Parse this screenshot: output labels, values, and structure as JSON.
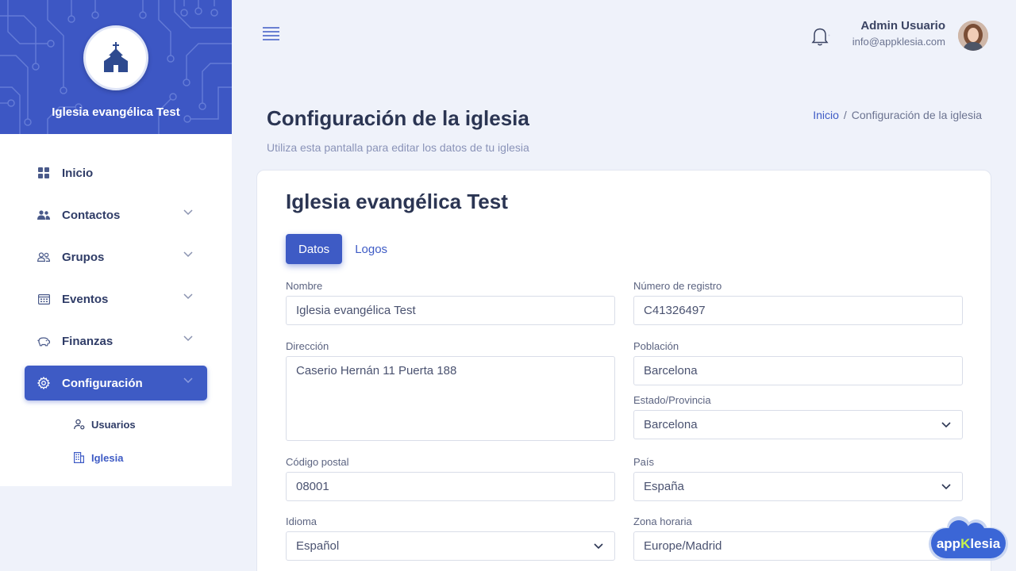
{
  "brand": {
    "name": "Iglesia evangélica Test"
  },
  "nav": {
    "items": [
      {
        "label": "Inicio"
      },
      {
        "label": "Contactos"
      },
      {
        "label": "Grupos"
      },
      {
        "label": "Eventos"
      },
      {
        "label": "Finanzas"
      },
      {
        "label": "Configuración"
      }
    ],
    "sub": [
      {
        "label": "Usuarios"
      },
      {
        "label": "Iglesia"
      }
    ]
  },
  "header": {
    "user_name": "Admin Usuario",
    "user_email": "info@appklesia.com"
  },
  "page": {
    "title": "Configuración de la iglesia",
    "subtitle": "Utiliza esta pantalla para editar los datos de tu iglesia",
    "breadcrumb": {
      "home": "Inicio",
      "sep": "/",
      "current": "Configuración de la iglesia"
    }
  },
  "card": {
    "title": "Iglesia evangélica Test",
    "tabs": [
      {
        "label": "Datos"
      },
      {
        "label": "Logos"
      }
    ]
  },
  "form": {
    "nombre": {
      "label": "Nombre",
      "value": "Iglesia evangélica Test"
    },
    "registro": {
      "label": "Número de registro",
      "value": "C41326497"
    },
    "direccion": {
      "label": "Dirección",
      "value": "Caserio Hernán 11 Puerta 188"
    },
    "poblacion": {
      "label": "Población",
      "value": "Barcelona"
    },
    "provincia": {
      "label": "Estado/Provincia",
      "value": "Barcelona"
    },
    "cp": {
      "label": "Código postal",
      "value": "08001"
    },
    "pais": {
      "label": "País",
      "value": "España"
    },
    "idioma": {
      "label": "Idioma",
      "value": "Español"
    },
    "zona": {
      "label": "Zona horaria",
      "value": "Europe/Madrid"
    }
  },
  "badge": {
    "text_a": "app",
    "text_b": "K",
    "text_c": "lesia"
  },
  "colors": {
    "primary": "#3e5bc5",
    "brand_bg": "#3d57c4",
    "badge_accent": "#c6f24e"
  }
}
